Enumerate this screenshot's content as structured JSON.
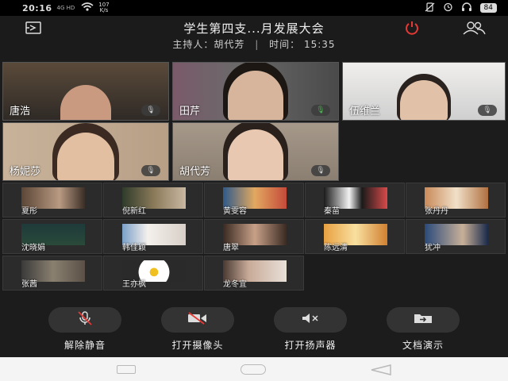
{
  "status_bar": {
    "time": "20:16",
    "network_labels": "4G HD",
    "speed_value": "107",
    "speed_unit": "K/s",
    "battery": "84"
  },
  "header": {
    "title": "学生第四支...月发展大会",
    "host_label": "主持人：胡代芳",
    "time_label": "时间：",
    "time_value": "15:35",
    "separator": "|"
  },
  "video_tiles": [
    {
      "name": "唐浩",
      "mic": "muted"
    },
    {
      "name": "田芹",
      "mic": "active"
    },
    {
      "name": "伍维兰",
      "mic": "muted"
    },
    {
      "name": "杨妮莎",
      "mic": "muted"
    },
    {
      "name": "胡代芳",
      "mic": "muted"
    }
  ],
  "participants": [
    {
      "name": "夏彤"
    },
    {
      "name": "倪新红"
    },
    {
      "name": "黄雯容"
    },
    {
      "name": "秦苗"
    },
    {
      "name": "张丹丹"
    },
    {
      "name": "沈晓娟"
    },
    {
      "name": "韩佳颖"
    },
    {
      "name": "唐翠"
    },
    {
      "name": "陈远清"
    },
    {
      "name": "犹冲"
    },
    {
      "name": "张茜"
    },
    {
      "name": "王亦枫"
    },
    {
      "name": "龙冬宜"
    }
  ],
  "controls": [
    {
      "label": "解除静音",
      "icon": "mic-muted-icon"
    },
    {
      "label": "打开摄像头",
      "icon": "camera-off-icon"
    },
    {
      "label": "打开扬声器",
      "icon": "speaker-off-icon"
    },
    {
      "label": "文档演示",
      "icon": "document-share-icon"
    }
  ],
  "colors": {
    "background": "#1c1c1c",
    "power_red": "#e53935",
    "active_mic_green": "#4caf50"
  }
}
